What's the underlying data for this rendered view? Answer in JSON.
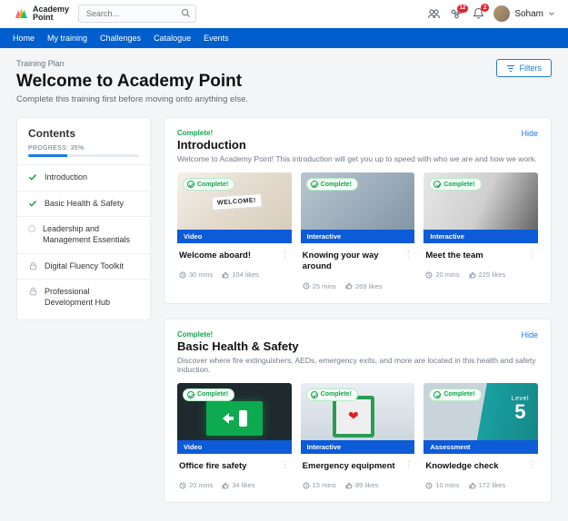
{
  "brand": {
    "name": "Academy\nPoint"
  },
  "search": {
    "placeholder": "Search..."
  },
  "notifications": {
    "group_badge": "12",
    "bell_badge": "2"
  },
  "user": {
    "name": "Soham"
  },
  "nav": {
    "items": [
      "Home",
      "My training",
      "Challenges",
      "Catalogue",
      "Events"
    ]
  },
  "page": {
    "crumb": "Training Plan",
    "title": "Welcome to Academy Point",
    "subtitle": "Complete this training first before moving onto anything else.",
    "filters_label": "Filters"
  },
  "sidebar": {
    "heading": "Contents",
    "progress_label": "PROGRESS: 35%",
    "progress_pct": 35,
    "items": [
      {
        "label": "Introduction",
        "state": "done"
      },
      {
        "label": "Basic Health & Safety",
        "state": "done"
      },
      {
        "label": "Leadership and Management Essentials",
        "state": "current"
      },
      {
        "label": "Digital Fluency Toolkit",
        "state": "locked"
      },
      {
        "label": "Professional Development Hub",
        "state": "locked"
      }
    ]
  },
  "sections": [
    {
      "status": "Complete!",
      "title": "Introduction",
      "hide": "Hide",
      "desc": "Welcome to Academy Point! This introduction will get you up to speed with who we are and how we work.",
      "cards": [
        {
          "badge": "Complete!",
          "ribbon": "Video",
          "title": "Welcome aboard!",
          "mins": "30 mins",
          "likes": "104 likes"
        },
        {
          "badge": "Complete!",
          "ribbon": "Interactive",
          "title": "Knowing your way around",
          "mins": "25 mins",
          "likes": "269 likes"
        },
        {
          "badge": "Complete!",
          "ribbon": "Interactive",
          "title": "Meet the team",
          "mins": "20 mins",
          "likes": "225 likes"
        }
      ]
    },
    {
      "status": "Complete!",
      "title": "Basic Health & Safety",
      "hide": "Hide",
      "desc": "Discover where fire extinguishers, AEDs, emergency exits, and more are located in this health and safety induction.",
      "cards": [
        {
          "badge": "Complete!",
          "ribbon": "Video",
          "title": "Office fire safety",
          "mins": "20 mins",
          "likes": "34 likes"
        },
        {
          "badge": "Complete!",
          "ribbon": "Interactive",
          "title": "Emergency equipment",
          "mins": "15 mins",
          "likes": "89 likes"
        },
        {
          "badge": "Complete!",
          "ribbon": "Assessment",
          "title": "Knowledge check",
          "mins": "10 mins",
          "likes": "172 likes"
        }
      ]
    }
  ]
}
